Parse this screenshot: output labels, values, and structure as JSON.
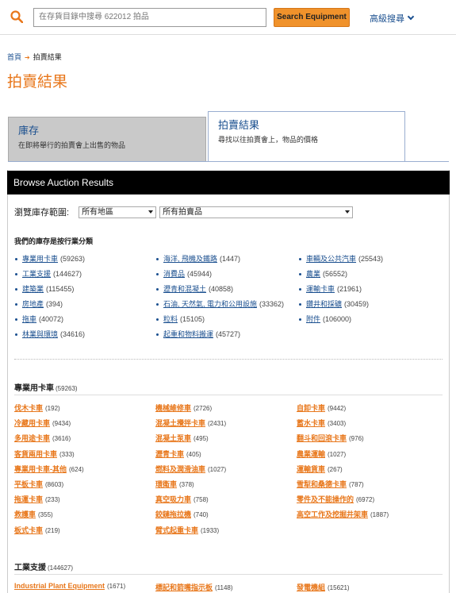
{
  "search": {
    "placeholder": "在存貨目錄中搜尋 622012 拍品",
    "button_label": "Search Equipment",
    "advanced_label": "高級搜尋"
  },
  "breadcrumb": {
    "home": "首頁",
    "current": "拍賣結果"
  },
  "page_title": "拍賣結果",
  "tabs": [
    {
      "title": "庫存",
      "subtitle": "在即將舉行的拍賣會上出售的物品"
    },
    {
      "title": "拍賣結果",
      "subtitle": "尋找以往拍賣會上，物品的價格"
    }
  ],
  "panel_header": "Browse Auction Results",
  "browse": {
    "label": "瀏覽庫存範圍:",
    "region_value": "所有地區",
    "item_value": "所有拍賣品"
  },
  "industry_heading": "我們的庫存是按行業分類",
  "industry_columns": [
    [
      {
        "label": "專業用卡車",
        "count": "(59263)"
      },
      {
        "label": "工業支援",
        "count": "(144627)"
      },
      {
        "label": "建築業",
        "count": "(115455)"
      },
      {
        "label": "房地產",
        "count": "(394)"
      },
      {
        "label": "拖車",
        "count": "(40072)"
      },
      {
        "label": "林業與環境",
        "count": "(34616)"
      }
    ],
    [
      {
        "label": "海洋, 飛機及鐵路",
        "count": "(1447)"
      },
      {
        "label": "消費品",
        "count": "(45944)"
      },
      {
        "label": "瀝青和混凝土",
        "count": "(40858)"
      },
      {
        "label": "石油, 天然氣, 電力和公用設施",
        "count": "(33362)"
      },
      {
        "label": "粒料",
        "count": "(15105)"
      },
      {
        "label": "起重和物料搬運",
        "count": "(45727)"
      }
    ],
    [
      {
        "label": "車輛及公共汽車",
        "count": "(25543)"
      },
      {
        "label": "農業",
        "count": "(56552)"
      },
      {
        "label": "運輸卡車",
        "count": "(21961)"
      },
      {
        "label": "鑽井和採礦",
        "count": "(30459)"
      },
      {
        "label": "附件",
        "count": "(106000)"
      }
    ]
  ],
  "sections": [
    {
      "title": "專業用卡車",
      "count": "(59263)",
      "rows": [
        [
          {
            "label": "伐木卡車",
            "count": "(192)"
          },
          {
            "label": "機械維修車",
            "count": "(2726)"
          },
          {
            "label": "自卸卡車",
            "count": "(9442)"
          }
        ],
        [
          {
            "label": "冷藏用卡車",
            "count": "(9434)"
          },
          {
            "label": "混凝土攪拌卡車",
            "count": "(2431)"
          },
          {
            "label": "蓄水卡車",
            "count": "(3403)"
          }
        ],
        [
          {
            "label": "多用途卡車",
            "count": "(3616)"
          },
          {
            "label": "混凝土泵車",
            "count": "(495)"
          },
          {
            "label": "翻斗和回滾卡車",
            "count": "(976)"
          }
        ],
        [
          {
            "label": "客貨兩用卡車",
            "count": "(333)"
          },
          {
            "label": "瀝青卡車",
            "count": "(405)"
          },
          {
            "label": "農業運輸",
            "count": "(1027)"
          }
        ],
        [
          {
            "label": "專業用卡車-其他",
            "count": "(624)"
          },
          {
            "label": "燃料及潤滑油車",
            "count": "(1027)"
          },
          {
            "label": "運輸貨車",
            "count": "(267)"
          }
        ],
        [
          {
            "label": "平板卡車",
            "count": "(8603)"
          },
          {
            "label": "環衛車",
            "count": "(378)"
          },
          {
            "label": "雪犁和桑德卡車",
            "count": "(787)"
          }
        ],
        [
          {
            "label": "拖運卡車",
            "count": "(233)"
          },
          {
            "label": "真空吸力車",
            "count": "(758)"
          },
          {
            "label": "零件及不能操作的",
            "count": "(6972)"
          }
        ],
        [
          {
            "label": "救護車",
            "count": "(355)"
          },
          {
            "label": "鉸鏈拖拉機",
            "count": "(740)"
          },
          {
            "label": "高空工作及挖掘井架車",
            "count": "(1887)"
          }
        ],
        [
          {
            "label": "板式卡車",
            "count": "(219)"
          },
          {
            "label": "臂式起重卡車",
            "count": "(1933)"
          },
          null
        ]
      ]
    },
    {
      "title": "工業支援",
      "count": "(144627)",
      "rows": [
        [
          {
            "label": "Industrial Plant Equipment",
            "count": "(1671)"
          },
          {
            "label": "標記和箭嘴指示板",
            "count": "(1148)"
          },
          {
            "label": "發電機組",
            "count": "(15621)"
          }
        ]
      ]
    }
  ]
}
